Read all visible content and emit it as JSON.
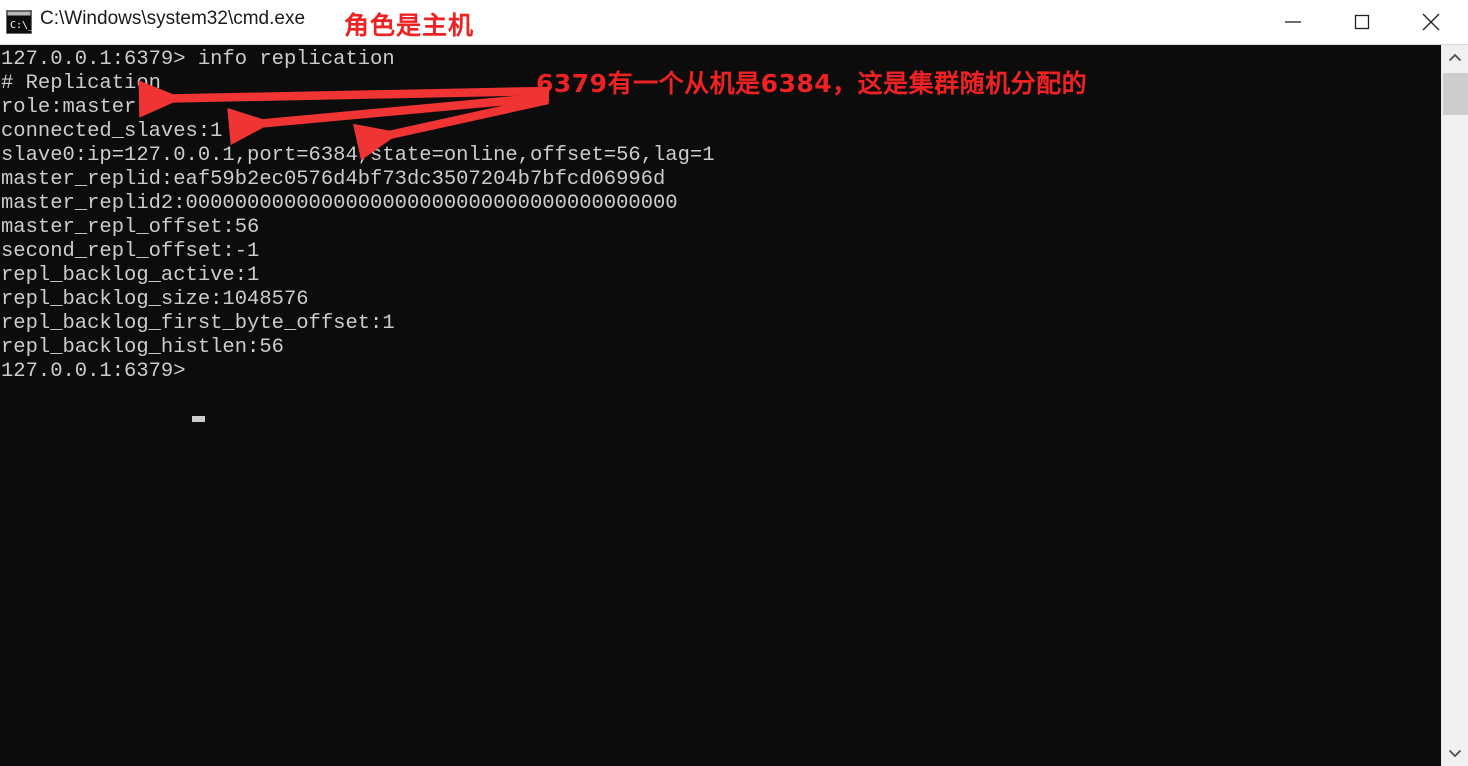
{
  "window": {
    "title": "C:\\Windows\\system32\\cmd.exe",
    "icon": "cmd-console-icon",
    "background_color": "#0c0c0c",
    "text_color": "#cccccc",
    "titlebar_color": "#ffffff"
  },
  "controls": {
    "minimize_label": "Minimize",
    "maximize_label": "Maximize",
    "close_label": "Close"
  },
  "annotations": {
    "color": "#ee2222",
    "title_note": "角色是主机",
    "console_note": "6379有一个从机是6384，这是集群随机分配的",
    "arrows": [
      {
        "name": "arrow-to-role-master",
        "target": "role:master"
      },
      {
        "name": "arrow-to-connected-slaves",
        "target": "connected_slaves:1"
      },
      {
        "name": "arrow-to-slave-port",
        "target": "port=6384"
      }
    ]
  },
  "console": {
    "prompt": "127.0.0.1:6379>",
    "command": "info replication",
    "lines": [
      "127.0.0.1:6379> info replication",
      "# Replication",
      "role:master",
      "connected_slaves:1",
      "slave0:ip=127.0.0.1,port=6384,state=online,offset=56,lag=1",
      "master_replid:eaf59b2ec0576d4bf73dc3507204b7bfcd06996d",
      "master_replid2:0000000000000000000000000000000000000000",
      "master_repl_offset:56",
      "second_repl_offset:-1",
      "repl_backlog_active:1",
      "repl_backlog_size:1048576",
      "repl_backlog_first_byte_offset:1",
      "repl_backlog_histlen:56",
      "127.0.0.1:6379>"
    ],
    "fields": {
      "section": "# Replication",
      "role": "master",
      "connected_slaves": "1",
      "slave0": "ip=127.0.0.1,port=6384,state=online,offset=56,lag=1",
      "master_replid": "eaf59b2ec0576d4bf73dc3507204b7bfcd06996d",
      "master_replid2": "0000000000000000000000000000000000000000",
      "master_repl_offset": "56",
      "second_repl_offset": "-1",
      "repl_backlog_active": "1",
      "repl_backlog_size": "1048576",
      "repl_backlog_first_byte_offset": "1",
      "repl_backlog_histlen": "56"
    }
  },
  "scrollbar": {
    "up_arrow": "chevron-up-icon",
    "down_arrow": "chevron-down-icon"
  }
}
